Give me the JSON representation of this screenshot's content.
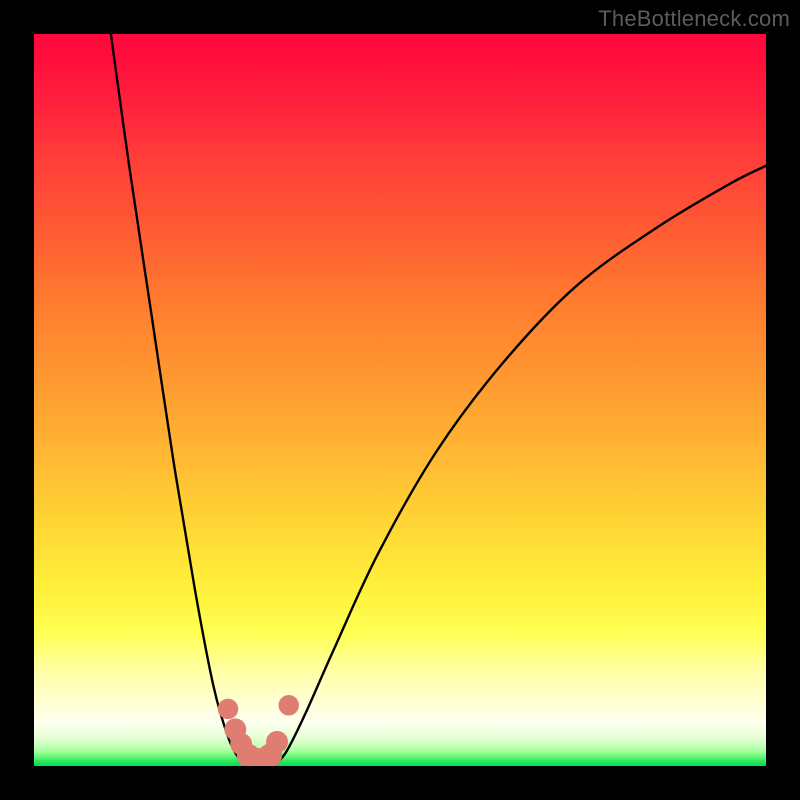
{
  "watermark": "TheBottleneck.com",
  "chart_data": {
    "type": "line",
    "title": "",
    "xlabel": "",
    "ylabel": "",
    "xlim": [
      0,
      100
    ],
    "ylim": [
      0,
      100
    ],
    "grid": false,
    "legend": false,
    "background_gradient": {
      "type": "vertical",
      "stops": [
        {
          "pos": 0.0,
          "color": "#ff0a3c"
        },
        {
          "pos": 0.16,
          "color": "#ff3a3a"
        },
        {
          "pos": 0.36,
          "color": "#ff7a2f"
        },
        {
          "pos": 0.58,
          "color": "#ffb933"
        },
        {
          "pos": 0.76,
          "color": "#fff13b"
        },
        {
          "pos": 0.91,
          "color": "#ffffd5"
        },
        {
          "pos": 0.98,
          "color": "#9cff95"
        },
        {
          "pos": 1.0,
          "color": "#00de55"
        }
      ]
    },
    "series": [
      {
        "name": "left-branch",
        "x": [
          10.5,
          13.0,
          16.0,
          19.0,
          22.0,
          24.5,
          26.5,
          28.0,
          29.0
        ],
        "y": [
          100.0,
          82.0,
          62.0,
          42.0,
          24.0,
          11.0,
          4.0,
          1.0,
          0.2
        ]
      },
      {
        "name": "right-branch",
        "x": [
          33.0,
          34.5,
          37.0,
          41.0,
          47.0,
          55.0,
          64.0,
          74.0,
          85.0,
          95.0,
          100.0
        ],
        "y": [
          0.3,
          2.0,
          7.0,
          16.0,
          29.0,
          43.0,
          55.0,
          65.5,
          73.5,
          79.5,
          82.0
        ]
      },
      {
        "name": "trough-floor",
        "x": [
          29.0,
          30.0,
          31.0,
          32.0,
          33.0
        ],
        "y": [
          0.2,
          0.05,
          0.03,
          0.05,
          0.3
        ]
      }
    ],
    "markers": {
      "name": "highlight-dots",
      "color": "#e07d73",
      "points": [
        {
          "x": 26.5,
          "y": 7.8,
          "r": 1.4
        },
        {
          "x": 27.5,
          "y": 5.0,
          "r": 1.5
        },
        {
          "x": 28.3,
          "y": 3.0,
          "r": 1.5
        },
        {
          "x": 29.3,
          "y": 1.4,
          "r": 1.6
        },
        {
          "x": 30.3,
          "y": 0.9,
          "r": 1.6
        },
        {
          "x": 31.3,
          "y": 0.9,
          "r": 1.6
        },
        {
          "x": 32.3,
          "y": 1.5,
          "r": 1.6
        },
        {
          "x": 33.2,
          "y": 3.3,
          "r": 1.5
        },
        {
          "x": 34.8,
          "y": 8.3,
          "r": 1.4
        }
      ]
    }
  }
}
